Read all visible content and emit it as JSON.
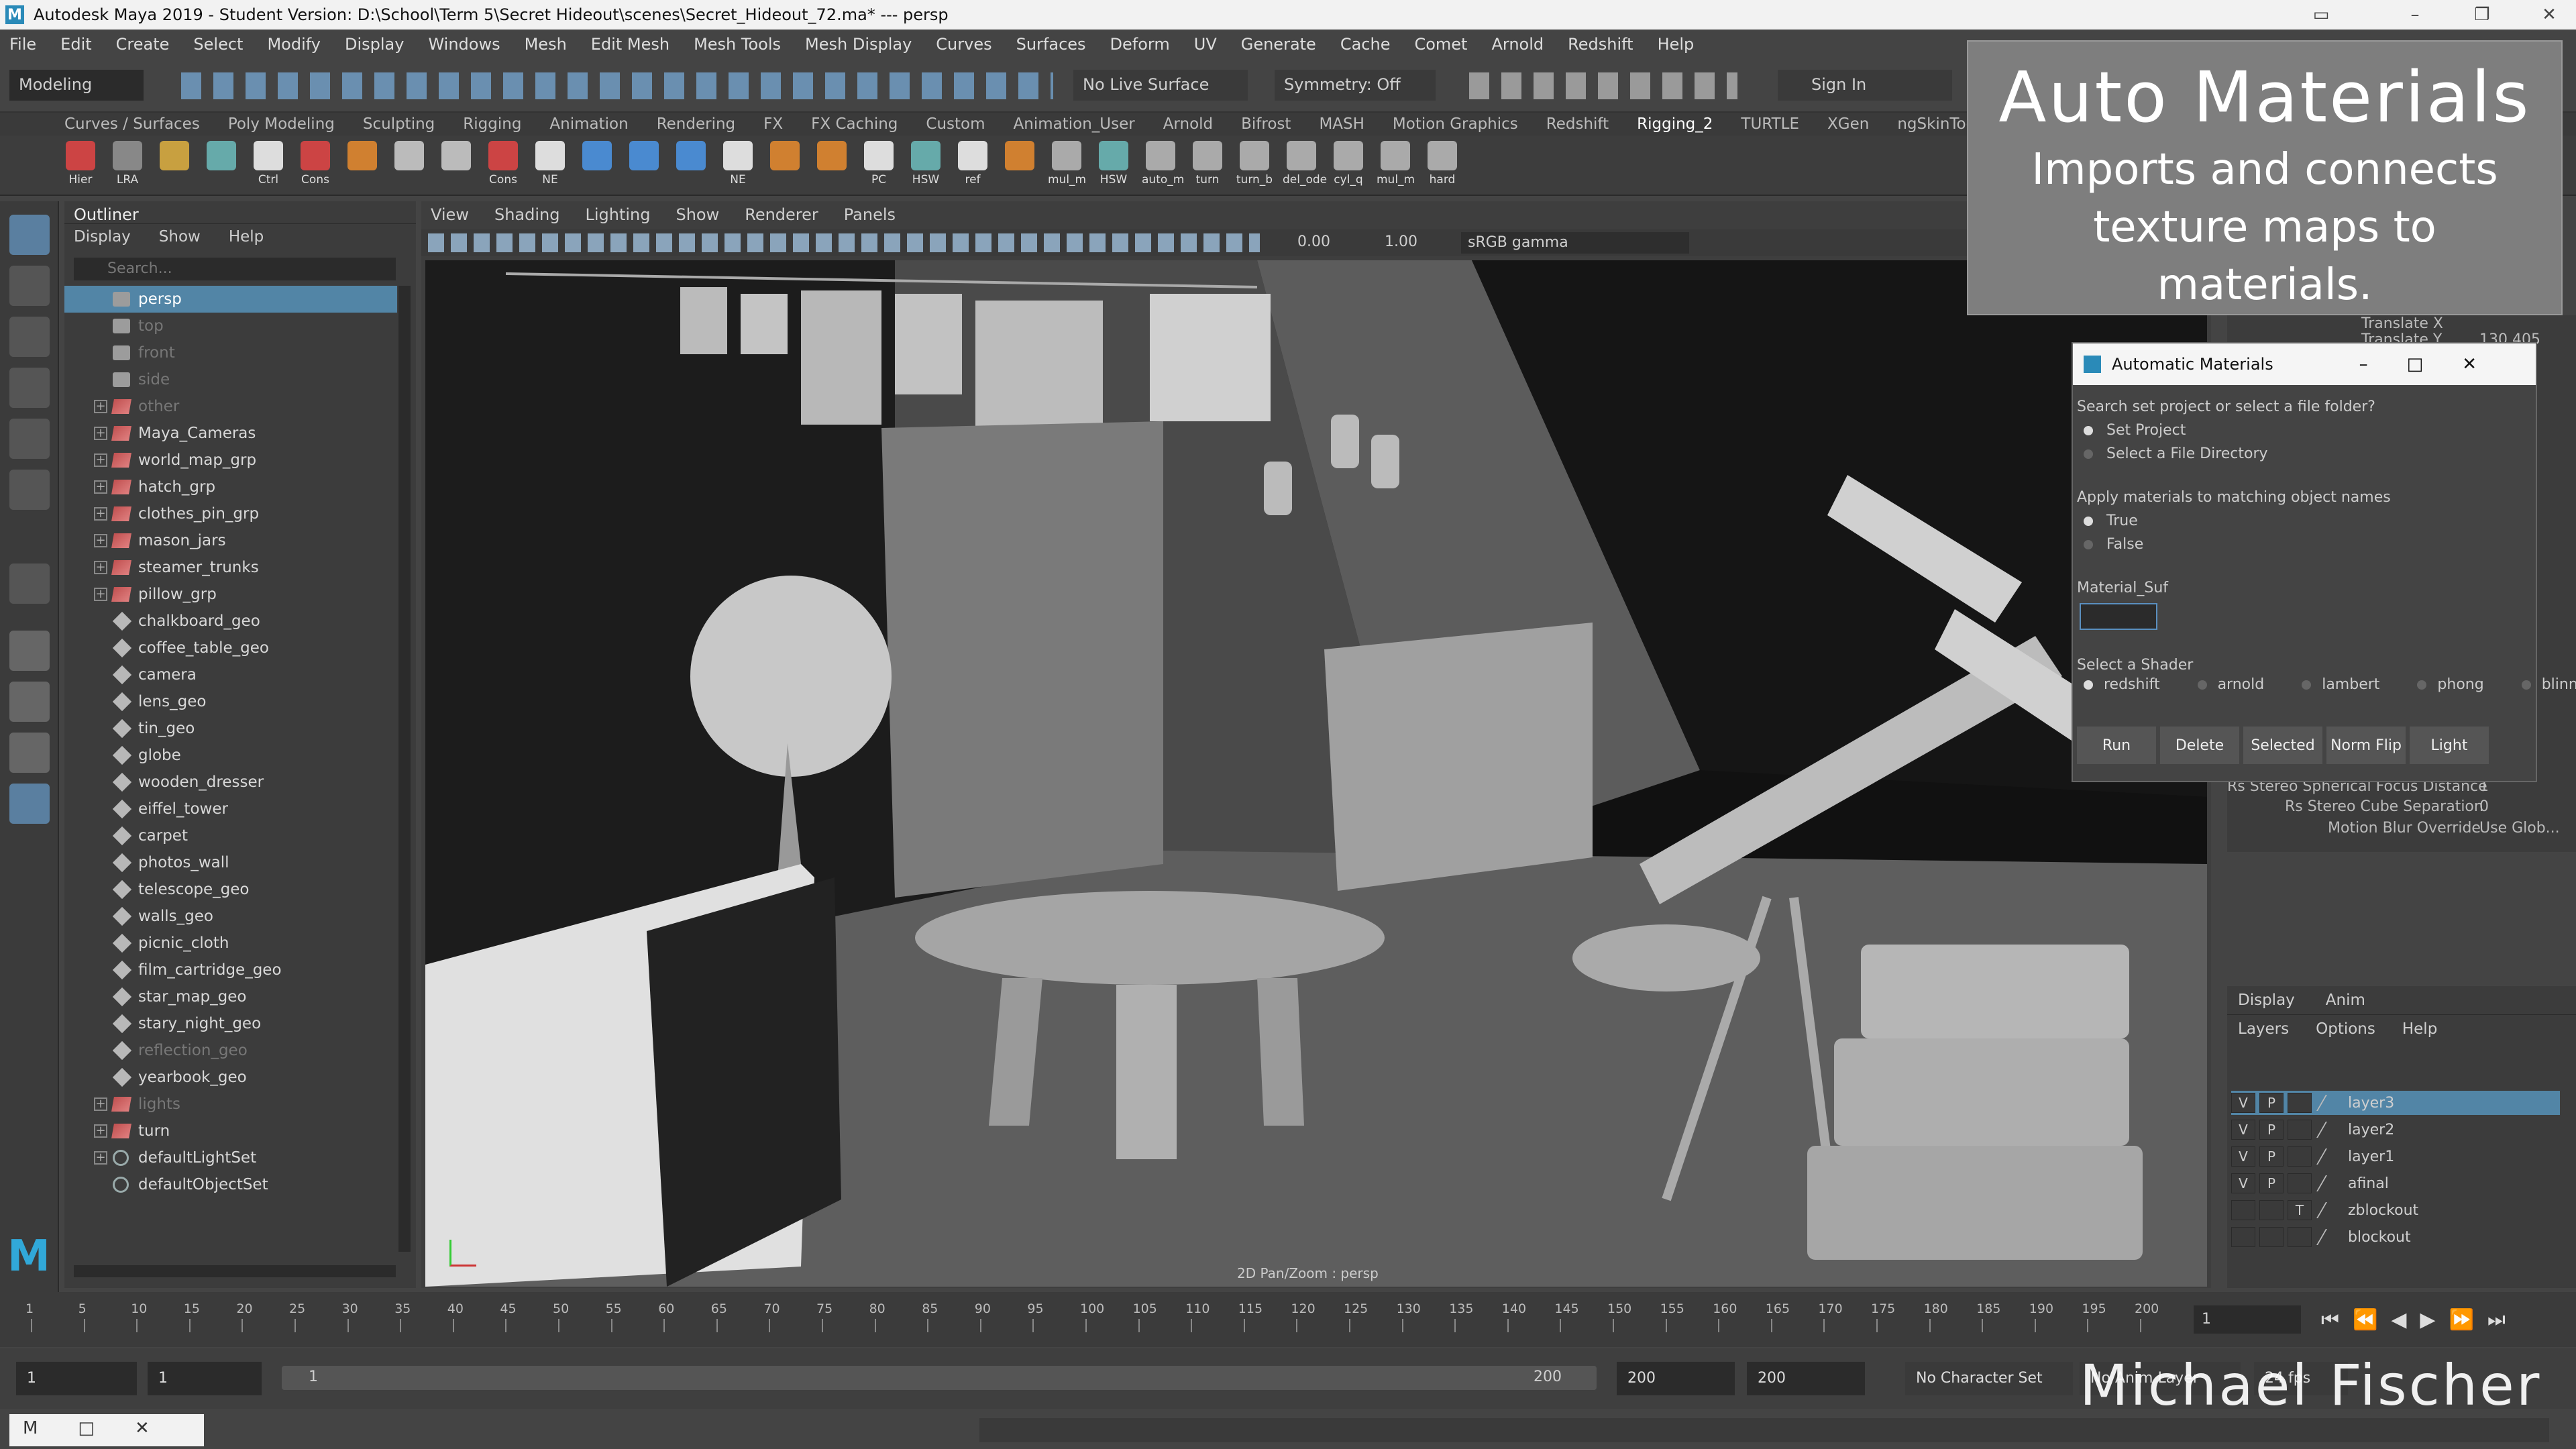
{
  "window": {
    "title": "Autodesk Maya 2019 - Student Version: D:\\School\\Term 5\\Secret Hideout\\scenes\\Secret_Hideout_72.ma*   ---   persp"
  },
  "menu": [
    "File",
    "Edit",
    "Create",
    "Select",
    "Modify",
    "Display",
    "Windows",
    "Mesh",
    "Edit Mesh",
    "Mesh Tools",
    "Mesh Display",
    "Curves",
    "Surfaces",
    "Deform",
    "UV",
    "Generate",
    "Cache",
    "Comet",
    "Arnold",
    "Redshift",
    "Help"
  ],
  "statusline": {
    "mode": "Modeling",
    "live_surface": "No Live Surface",
    "symmetry": "Symmetry: Off",
    "sign_in": "Sign In"
  },
  "shelf_tabs": [
    "Curves / Surfaces",
    "Poly Modeling",
    "Sculpting",
    "Rigging",
    "Animation",
    "Rendering",
    "FX",
    "FX Caching",
    "Custom",
    "Animation_User",
    "Arnold",
    "Bifrost",
    "MASH",
    "Motion Graphics",
    "Redshift",
    "Rigging_2",
    "TURTLE",
    "XGen",
    "ngSkinTools"
  ],
  "shelf_icons": [
    "Hier",
    "LRA",
    "",
    "",
    "Ctrl",
    "Cons",
    "",
    "",
    "",
    "Cons",
    "NE",
    "",
    "",
    "",
    "NE",
    "",
    "",
    "PC",
    "HSW",
    "ref",
    "",
    "mul_m",
    "HSW",
    "auto_m",
    "turn",
    "turn_b",
    "del_ode",
    "cyl_q",
    "mul_m",
    "hard"
  ],
  "outliner": {
    "title": "Outliner",
    "menu": [
      "Display",
      "Show",
      "Help"
    ],
    "search_placeholder": "Search...",
    "items": [
      {
        "label": "persp",
        "kind": "cam",
        "state": "sel"
      },
      {
        "label": "top",
        "kind": "cam",
        "state": "dim"
      },
      {
        "label": "front",
        "kind": "cam",
        "state": "dim"
      },
      {
        "label": "side",
        "kind": "cam",
        "state": "dim"
      },
      {
        "label": "other",
        "kind": "grp",
        "state": "dim",
        "exp": true
      },
      {
        "label": "Maya_Cameras",
        "kind": "grp",
        "exp": true
      },
      {
        "label": "world_map_grp",
        "kind": "grp",
        "exp": true
      },
      {
        "label": "hatch_grp",
        "kind": "grp",
        "exp": true
      },
      {
        "label": "clothes_pin_grp",
        "kind": "grp",
        "exp": true
      },
      {
        "label": "mason_jars",
        "kind": "grp",
        "exp": true
      },
      {
        "label": "steamer_trunks",
        "kind": "grp",
        "exp": true
      },
      {
        "label": "pillow_grp",
        "kind": "grp",
        "exp": true
      },
      {
        "label": "chalkboard_geo",
        "kind": "geo"
      },
      {
        "label": "coffee_table_geo",
        "kind": "geo"
      },
      {
        "label": "camera",
        "kind": "geo"
      },
      {
        "label": "lens_geo",
        "kind": "geo"
      },
      {
        "label": "tin_geo",
        "kind": "geo"
      },
      {
        "label": "globe",
        "kind": "geo"
      },
      {
        "label": "wooden_dresser",
        "kind": "geo"
      },
      {
        "label": "eiffel_tower",
        "kind": "geo"
      },
      {
        "label": "carpet",
        "kind": "geo"
      },
      {
        "label": "photos_wall",
        "kind": "geo"
      },
      {
        "label": "telescope_geo",
        "kind": "geo"
      },
      {
        "label": "walls_geo",
        "kind": "geo"
      },
      {
        "label": "picnic_cloth",
        "kind": "geo"
      },
      {
        "label": "film_cartridge_geo",
        "kind": "geo"
      },
      {
        "label": "star_map_geo",
        "kind": "geo"
      },
      {
        "label": "stary_night_geo",
        "kind": "geo"
      },
      {
        "label": "reflection_geo",
        "kind": "geo",
        "state": "dim"
      },
      {
        "label": "yearbook_geo",
        "kind": "geo"
      },
      {
        "label": "lights",
        "kind": "grp",
        "state": "dim",
        "exp": true
      },
      {
        "label": "turn",
        "kind": "grp",
        "exp": true
      },
      {
        "label": "defaultLightSet",
        "kind": "set",
        "exp": true
      },
      {
        "label": "defaultObjectSet",
        "kind": "set"
      }
    ]
  },
  "viewport": {
    "menu": [
      "View",
      "Shading",
      "Lighting",
      "Show",
      "Renderer",
      "Panels"
    ],
    "exposure": "0.00",
    "gamma": "1.00",
    "colorspace": "sRGB gamma",
    "label": "2D Pan/Zoom : persp"
  },
  "dialog": {
    "title": "Automatic Materials",
    "q1": "Search set project or select a file folder?",
    "q1_opts": [
      "Set Project",
      "Select a File Directory"
    ],
    "q2": "Apply materials to matching object names",
    "q2_opts": [
      "True",
      "False"
    ],
    "field_label": "Material_Suf",
    "field_value": "",
    "shader_label": "Select a Shader",
    "shaders": [
      "redshift",
      "arnold",
      "lambert",
      "phong",
      "blinn"
    ],
    "buttons": [
      "Run",
      "Delete",
      "Selected",
      "Norm Flip",
      "Light"
    ]
  },
  "promo": {
    "title": "Auto Materials",
    "line1": "Imports and connects",
    "line2": "texture maps to",
    "line3": "materials."
  },
  "attributes": {
    "translate_x": "Translate X",
    "translate_y": "Translate Y",
    "translate_y_val": "130.405",
    "focus": "Rs Stereo Spherical Focus Distance",
    "focus_val": "1",
    "cube_sep": "Rs Stereo Cube Separation",
    "cube_sep_val": "0",
    "motion_blur": "Motion Blur Override",
    "motion_blur_val": "Use Glob..."
  },
  "layers": {
    "tabs": [
      "Display",
      "Anim"
    ],
    "menu": [
      "Layers",
      "Options",
      "Help"
    ],
    "rows": [
      {
        "v": "V",
        "p": "P",
        "t": "",
        "name": "layer3",
        "sel": true
      },
      {
        "v": "V",
        "p": "P",
        "t": "",
        "name": "layer2"
      },
      {
        "v": "V",
        "p": "P",
        "t": "",
        "name": "layer1"
      },
      {
        "v": "V",
        "p": "P",
        "t": "",
        "name": "afinal"
      },
      {
        "v": "",
        "p": "",
        "t": "T",
        "name": "zblockout"
      },
      {
        "v": "",
        "p": "",
        "t": "",
        "name": "blockout"
      }
    ]
  },
  "timeline": {
    "ticks": [
      "1",
      "5",
      "10",
      "15",
      "20",
      "25",
      "30",
      "35",
      "40",
      "45",
      "50",
      "55",
      "60",
      "65",
      "70",
      "75",
      "80",
      "85",
      "90",
      "95",
      "100",
      "105",
      "110",
      "115",
      "120",
      "125",
      "130",
      "135",
      "140",
      "145",
      "150",
      "155",
      "160",
      "165",
      "170",
      "175",
      "180",
      "185",
      "190",
      "195",
      "200"
    ],
    "current": "1"
  },
  "range": {
    "start": "1",
    "inner_start": "1",
    "slider_start": "1",
    "slider_end": "200",
    "end": "200",
    "outer_end": "200",
    "char_set": "No Character Set",
    "anim_layer": "No Anim Layer",
    "fps": "24 fps"
  },
  "signature": "Michael Fischer"
}
